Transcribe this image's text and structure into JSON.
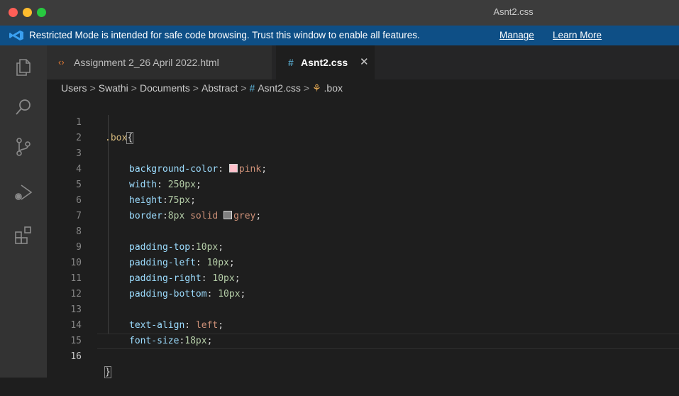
{
  "window": {
    "title": "Asnt2.css"
  },
  "banner": {
    "message": "Restricted Mode is intended for safe code browsing. Trust this window to enable all features.",
    "manage": "Manage",
    "learn_more": "Learn More"
  },
  "tabs": [
    {
      "icon": "‹›",
      "label": "Assignment 2_26 April 2022.html"
    },
    {
      "icon": "#",
      "label": "Asnt2.css",
      "close": "✕"
    }
  ],
  "breadcrumb": {
    "parts": [
      "Users",
      "Swathi",
      "Documents",
      "Abstract"
    ],
    "file_icon": "#",
    "file": "Asnt2.css",
    "symbol": ".box",
    "separator": ">"
  },
  "colors": {
    "pink": "#ffc0cb",
    "grey": "#808080",
    "accent": "#0e4f86"
  },
  "editor": {
    "line_numbers": [
      "1",
      "2",
      "3",
      "4",
      "5",
      "6",
      "7",
      "8",
      "9",
      "10",
      "11",
      "12",
      "13",
      "14",
      "15",
      "16"
    ],
    "lines": {
      "l1_sel": ".box",
      "l1_brace": "{",
      "l3_prop": "background-color",
      "l3_colon": ": ",
      "l3_val": "pink",
      "l3_end": ";",
      "l4_prop": "width",
      "l4_colon": ": ",
      "l4_val": "250px",
      "l4_end": ";",
      "l5_prop": "height",
      "l5_colon": ":",
      "l5_val": "75px",
      "l5_end": ";",
      "l6_prop": "border",
      "l6_colon": ":",
      "l6_val1": "8px",
      "l6_val2": " solid ",
      "l6_val3": "grey",
      "l6_end": ";",
      "l8_prop": "padding-top",
      "l8_colon": ":",
      "l8_val": "10px",
      "l8_end": ";",
      "l9_prop": "padding-left",
      "l9_colon": ": ",
      "l9_val": "10px",
      "l9_end": ";",
      "l10_prop": "padding-right",
      "l10_colon": ": ",
      "l10_val": "10px",
      "l10_end": ";",
      "l11_prop": "padding-bottom",
      "l11_colon": ": ",
      "l11_val": "10px",
      "l11_end": ";",
      "l13_prop": "text-align",
      "l13_colon": ": ",
      "l13_val": "left",
      "l13_end": ";",
      "l14_prop": "font-size",
      "l14_colon": ":",
      "l14_val": "18px",
      "l14_end": ";",
      "l16_brace": "}"
    },
    "active_line": "16"
  },
  "activity_icons": [
    "explorer-icon",
    "search-icon",
    "source-control-icon",
    "run-debug-icon",
    "extensions-icon"
  ]
}
